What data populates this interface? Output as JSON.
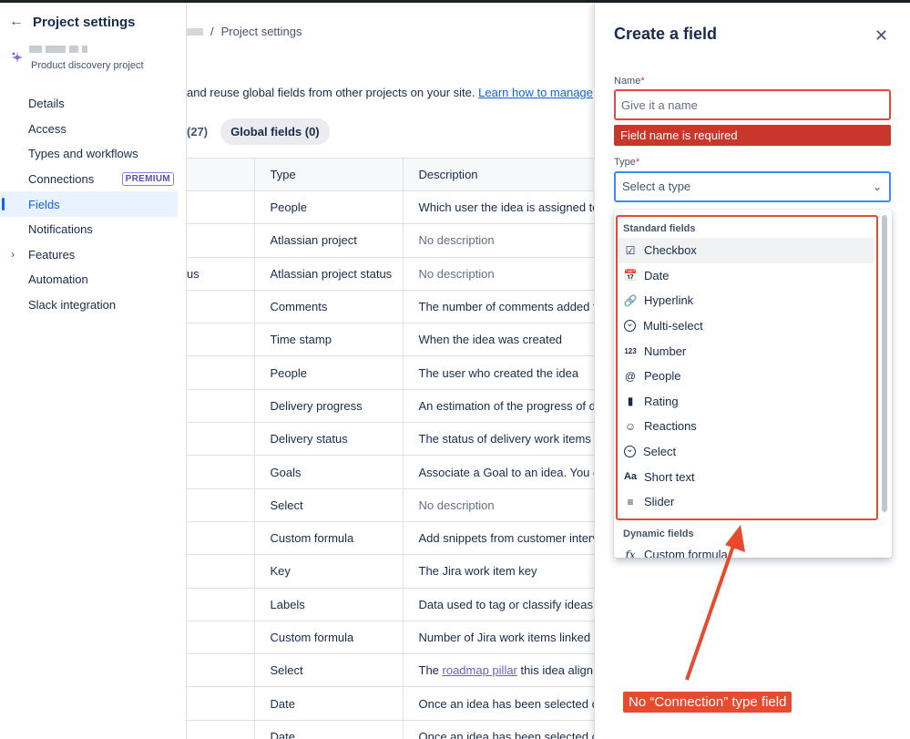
{
  "sidebar": {
    "title": "Project settings",
    "project_type": "Product discovery project",
    "items": [
      {
        "label": "Details"
      },
      {
        "label": "Access"
      },
      {
        "label": "Types and workflows"
      },
      {
        "label": "Connections",
        "badge": "PREMIUM"
      },
      {
        "label": "Fields",
        "active": true
      },
      {
        "label": "Notifications"
      },
      {
        "label": "Features",
        "expandable": true
      },
      {
        "label": "Automation"
      },
      {
        "label": "Slack integration"
      }
    ]
  },
  "breadcrumb": {
    "separator": "/",
    "current": "Project settings"
  },
  "intro": {
    "text": "and reuse global fields from other projects on your site.",
    "link": "Learn how to manage"
  },
  "tabs": {
    "project_count": "(27)",
    "global": "Global fields (0)"
  },
  "table": {
    "headers": {
      "type": "Type",
      "description": "Description"
    },
    "rows": [
      {
        "name": "",
        "type": "People",
        "desc": "Which user the idea is assigned to"
      },
      {
        "name": "",
        "type": "Atlassian project",
        "desc": "No description",
        "muted": true
      },
      {
        "name": "us",
        "type": "Atlassian project status",
        "desc": "No description",
        "muted": true
      },
      {
        "name": "",
        "type": "Comments",
        "desc": "The number of comments added t"
      },
      {
        "name": "",
        "type": "Time stamp",
        "desc": "When the idea was created"
      },
      {
        "name": "",
        "type": "People",
        "desc": "The user who created the idea"
      },
      {
        "name": "",
        "type": "Delivery progress",
        "desc": "An estimation of the progress of d"
      },
      {
        "name": "",
        "type": "Delivery status",
        "desc": "The status of delivery work items"
      },
      {
        "name": "",
        "type": "Goals",
        "desc": "Associate a Goal to an idea. You c"
      },
      {
        "name": "",
        "type": "Select",
        "desc": "No description",
        "muted": true
      },
      {
        "name": "",
        "type": "Custom formula",
        "desc": "Add snippets from customer interv"
      },
      {
        "name": "",
        "type": "Key",
        "desc": "The Jira work item key"
      },
      {
        "name": "",
        "type": "Labels",
        "desc": "Data used to tag or classify ideas"
      },
      {
        "name": "",
        "type": "Custom formula",
        "desc": "Number of Jira work items linked t"
      },
      {
        "name": "",
        "type": "Select",
        "desc_pre": "The ",
        "desc_link": "roadmap pillar",
        "desc_post": " this idea align"
      },
      {
        "name": "",
        "type": "Date",
        "desc": "Once an idea has been selected c"
      },
      {
        "name": "",
        "type": "Date",
        "desc": "Once an idea has been selected c"
      }
    ]
  },
  "panel": {
    "title": "Create a field",
    "name_label": "Name",
    "name_placeholder": "Give it a name",
    "error": "Field name is required",
    "type_label": "Type",
    "type_placeholder": "Select a type",
    "required_mark": "*",
    "standard_group": "Standard fields",
    "standard_fields": [
      {
        "label": "Checkbox",
        "icon": "checkbox-icon"
      },
      {
        "label": "Date",
        "icon": "calendar-icon"
      },
      {
        "label": "Hyperlink",
        "icon": "link-icon"
      },
      {
        "label": "Multi-select",
        "icon": "chevron-circle-icon"
      },
      {
        "label": "Number",
        "icon": "number-icon"
      },
      {
        "label": "People",
        "icon": "at-icon"
      },
      {
        "label": "Rating",
        "icon": "rating-bars-icon"
      },
      {
        "label": "Reactions",
        "icon": "smiley-icon"
      },
      {
        "label": "Select",
        "icon": "chevron-circle-icon"
      },
      {
        "label": "Short text",
        "icon": "text-aa-icon"
      },
      {
        "label": "Slider",
        "icon": "slider-icon"
      }
    ],
    "dynamic_group": "Dynamic fields",
    "dynamic_fields": [
      {
        "label": "Custom formula",
        "icon": "fx-icon"
      }
    ]
  },
  "annotation": {
    "text": "No “Connection” type field",
    "color": "#e84a2e"
  },
  "colors": {
    "accent": "#0c66e4",
    "error": "#c9372c",
    "premium": "#5e4db2"
  }
}
